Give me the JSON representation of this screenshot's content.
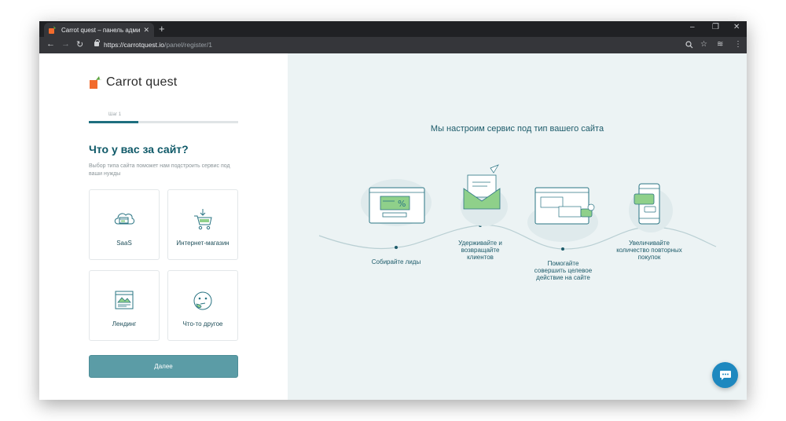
{
  "browser": {
    "tab_title": "Carrot quest – панель администр",
    "tab_close": "✕",
    "new_tab": "+",
    "url_host": "https://carrotquest.io",
    "url_path": "/panel/register/1",
    "window_controls": [
      "–",
      "❐",
      "✕"
    ]
  },
  "left": {
    "logo_text": "Carrot quest",
    "step_label": "Шаг 1",
    "progress": 0.33,
    "heading": "Что у вас за сайт?",
    "hint": "Выбор типа сайта поможет нам подстроить сервис под ваши нужды",
    "cards": [
      {
        "label": "SaaS",
        "icon": "cloud-browser-icon"
      },
      {
        "label": "Интернет-магазин",
        "icon": "shopping-cart-icon"
      },
      {
        "label": "Лендинг",
        "icon": "landing-page-icon"
      },
      {
        "label": "Что-то другое",
        "icon": "thinking-face-icon"
      }
    ],
    "next_button": "Далее"
  },
  "right": {
    "title": "Мы настроим сервис под тип вашего сайта",
    "captions": [
      "Собирайте лиды",
      "Удерживайте и возвращайте клиентов",
      "Помогайте совершить целевое действие на сайте",
      "Увеличивайте количество повторных покупок"
    ]
  },
  "colors": {
    "accent": "#0f5968",
    "button": "#5b9ca6",
    "panel_bg": "#ecf3f4",
    "illustration_green": "#8fd08a",
    "chat_button": "#1e88bf"
  }
}
